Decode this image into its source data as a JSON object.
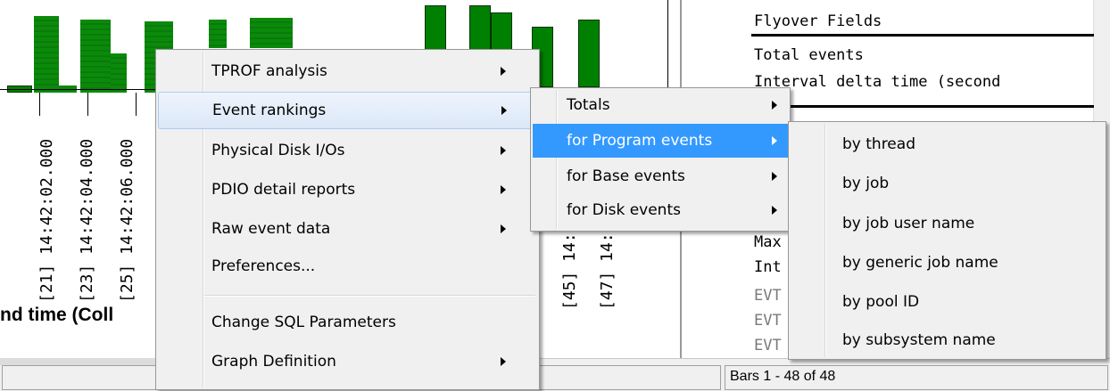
{
  "chart": {
    "x_labels": [
      "[21] 14:42:02.000",
      "[23] 14:42:04.000",
      "[25] 14:42:06.000",
      "[45] 14:",
      "[47] 14:"
    ],
    "x_axis_title": "nd time (Coll",
    "colors": {
      "bar": "#008000",
      "bar_border": "#003300"
    }
  },
  "right_panel": {
    "lines": [
      "Flyover Fields",
      "Total events",
      "Interval delta time (second",
      "Max",
      "Int",
      "EVT",
      "EVT",
      "EVT"
    ]
  },
  "status": {
    "bars_text": "Bars 1 - 48 of 48"
  },
  "context_menu": {
    "items": [
      {
        "label": "TPROF analysis"
      },
      {
        "label": "Event rankings"
      },
      {
        "label": "Physical Disk I/Os"
      },
      {
        "label": "PDIO detail reports"
      },
      {
        "label": "Raw event data"
      },
      {
        "label": "Preferences..."
      },
      {
        "label": "Change SQL Parameters"
      },
      {
        "label": "Graph Definition"
      }
    ]
  },
  "event_rankings_menu": {
    "items": [
      {
        "label": "Totals"
      },
      {
        "label": "for Program events"
      },
      {
        "label": "for Base events"
      },
      {
        "label": "for Disk events"
      }
    ]
  },
  "program_events_menu": {
    "items": [
      {
        "label": "by thread"
      },
      {
        "label": "by job"
      },
      {
        "label": "by job user name"
      },
      {
        "label": "by generic job name"
      },
      {
        "label": "by pool ID"
      },
      {
        "label": "by subsystem name"
      }
    ]
  },
  "icons": {
    "submenu_arrow": "triangle-right"
  },
  "accent": {
    "menu_highlight": "#3399ff",
    "menu_hover_border": "#aecbf0"
  }
}
